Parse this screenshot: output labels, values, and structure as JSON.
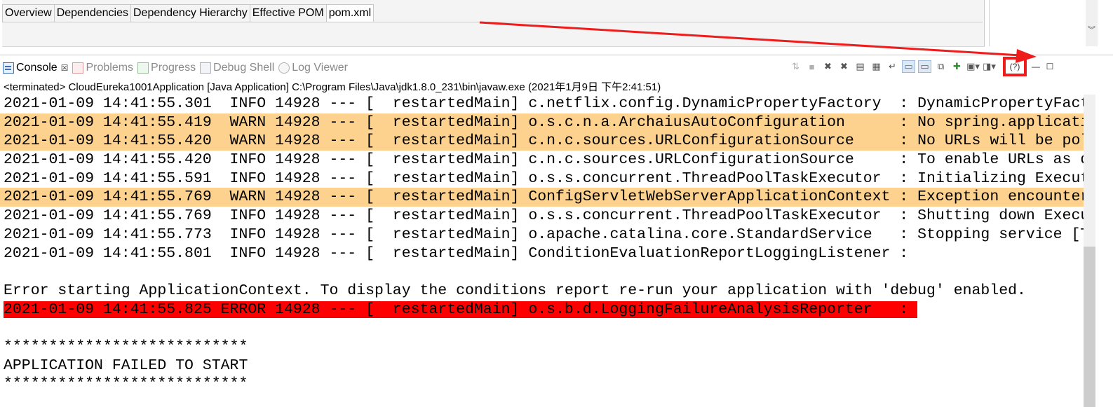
{
  "editor": {
    "tabs": [
      "Overview",
      "Dependencies",
      "Dependency Hierarchy",
      "Effective POM",
      "pom.xml"
    ],
    "active_tab": "pom.xml"
  },
  "views": {
    "tabs": [
      {
        "label": "Console",
        "icon": "console-icon",
        "active": true
      },
      {
        "label": "Problems",
        "icon": "problems-icon",
        "active": false
      },
      {
        "label": "Progress",
        "icon": "progress-icon",
        "active": false
      },
      {
        "label": "Debug Shell",
        "icon": "debug-shell-icon",
        "active": false
      },
      {
        "label": "Log Viewer",
        "icon": "log-viewer-icon",
        "active": false
      }
    ],
    "console_close": "☒"
  },
  "toolbar": {
    "icons": [
      "disconnect-icon",
      "terminate-icon",
      "remove-launch-icon",
      "remove-all-terminated-icon",
      "clear-console-icon",
      "scroll-lock-icon",
      "word-wrap-icon",
      "show-on-stdout-icon",
      "show-on-stderr-icon",
      "pin-console-icon",
      "new-console-icon",
      "display-console-icon",
      "open-console-icon",
      "help-icon",
      "minimize-icon",
      "maximize-icon"
    ],
    "help_label": "(?)",
    "minimize_label": "—",
    "maximize_label": "☐"
  },
  "status_line": "<terminated> CloudEureka1001Application [Java Application] C:\\Program Files\\Java\\jdk1.8.0_231\\bin\\javaw.exe (2021年1月9日 下午2:41:51)",
  "log": [
    {
      "type": "info",
      "text": "2021-01-09 14:41:55.301  INFO 14928 --- [  restartedMain] c.netflix.config.DynamicPropertyFactory  : DynamicPropertyFact"
    },
    {
      "type": "warn",
      "text": "2021-01-09 14:41:55.419  WARN 14928 --- [  restartedMain] o.s.c.n.a.ArchaiusAutoConfiguration      : No spring.applicati"
    },
    {
      "type": "warn",
      "text": "2021-01-09 14:41:55.420  WARN 14928 --- [  restartedMain] c.n.c.sources.URLConfigurationSource     : No URLs will be pol"
    },
    {
      "type": "info",
      "text": "2021-01-09 14:41:55.420  INFO 14928 --- [  restartedMain] c.n.c.sources.URLConfigurationSource     : To enable URLs as d"
    },
    {
      "type": "info",
      "text": "2021-01-09 14:41:55.591  INFO 14928 --- [  restartedMain] o.s.s.concurrent.ThreadPoolTaskExecutor  : Initializing Execut"
    },
    {
      "type": "warn",
      "text": "2021-01-09 14:41:55.769  WARN 14928 --- [  restartedMain] ConfigServletWebServerApplicationContext : Exception encounter"
    },
    {
      "type": "info",
      "text": "2021-01-09 14:41:55.769  INFO 14928 --- [  restartedMain] o.s.s.concurrent.ThreadPoolTaskExecutor  : Shutting down Execu"
    },
    {
      "type": "info",
      "text": "2021-01-09 14:41:55.773  INFO 14928 --- [  restartedMain] o.apache.catalina.core.StandardService   : Stopping service [T"
    },
    {
      "type": "info",
      "text": "2021-01-09 14:41:55.801  INFO 14928 --- [  restartedMain] ConditionEvaluationReportLoggingListener : "
    },
    {
      "type": "blank",
      "text": ""
    },
    {
      "type": "info",
      "text": "Error starting ApplicationContext. To display the conditions report re-run your application with 'debug' enabled."
    },
    {
      "type": "error",
      "text": "2021-01-09 14:41:55.825 ERROR 14928 --- [  restartedMain] o.s.b.d.LoggingFailureAnalysisReporter   : "
    },
    {
      "type": "blank",
      "text": ""
    },
    {
      "type": "info",
      "text": "***************************"
    },
    {
      "type": "info",
      "text": "APPLICATION FAILED TO START"
    },
    {
      "type": "info",
      "text": "***************************"
    }
  ],
  "colors": {
    "warn_highlight": "#fdd28f",
    "error_highlight": "#ff0000",
    "annotation": "#ef1c1c"
  }
}
